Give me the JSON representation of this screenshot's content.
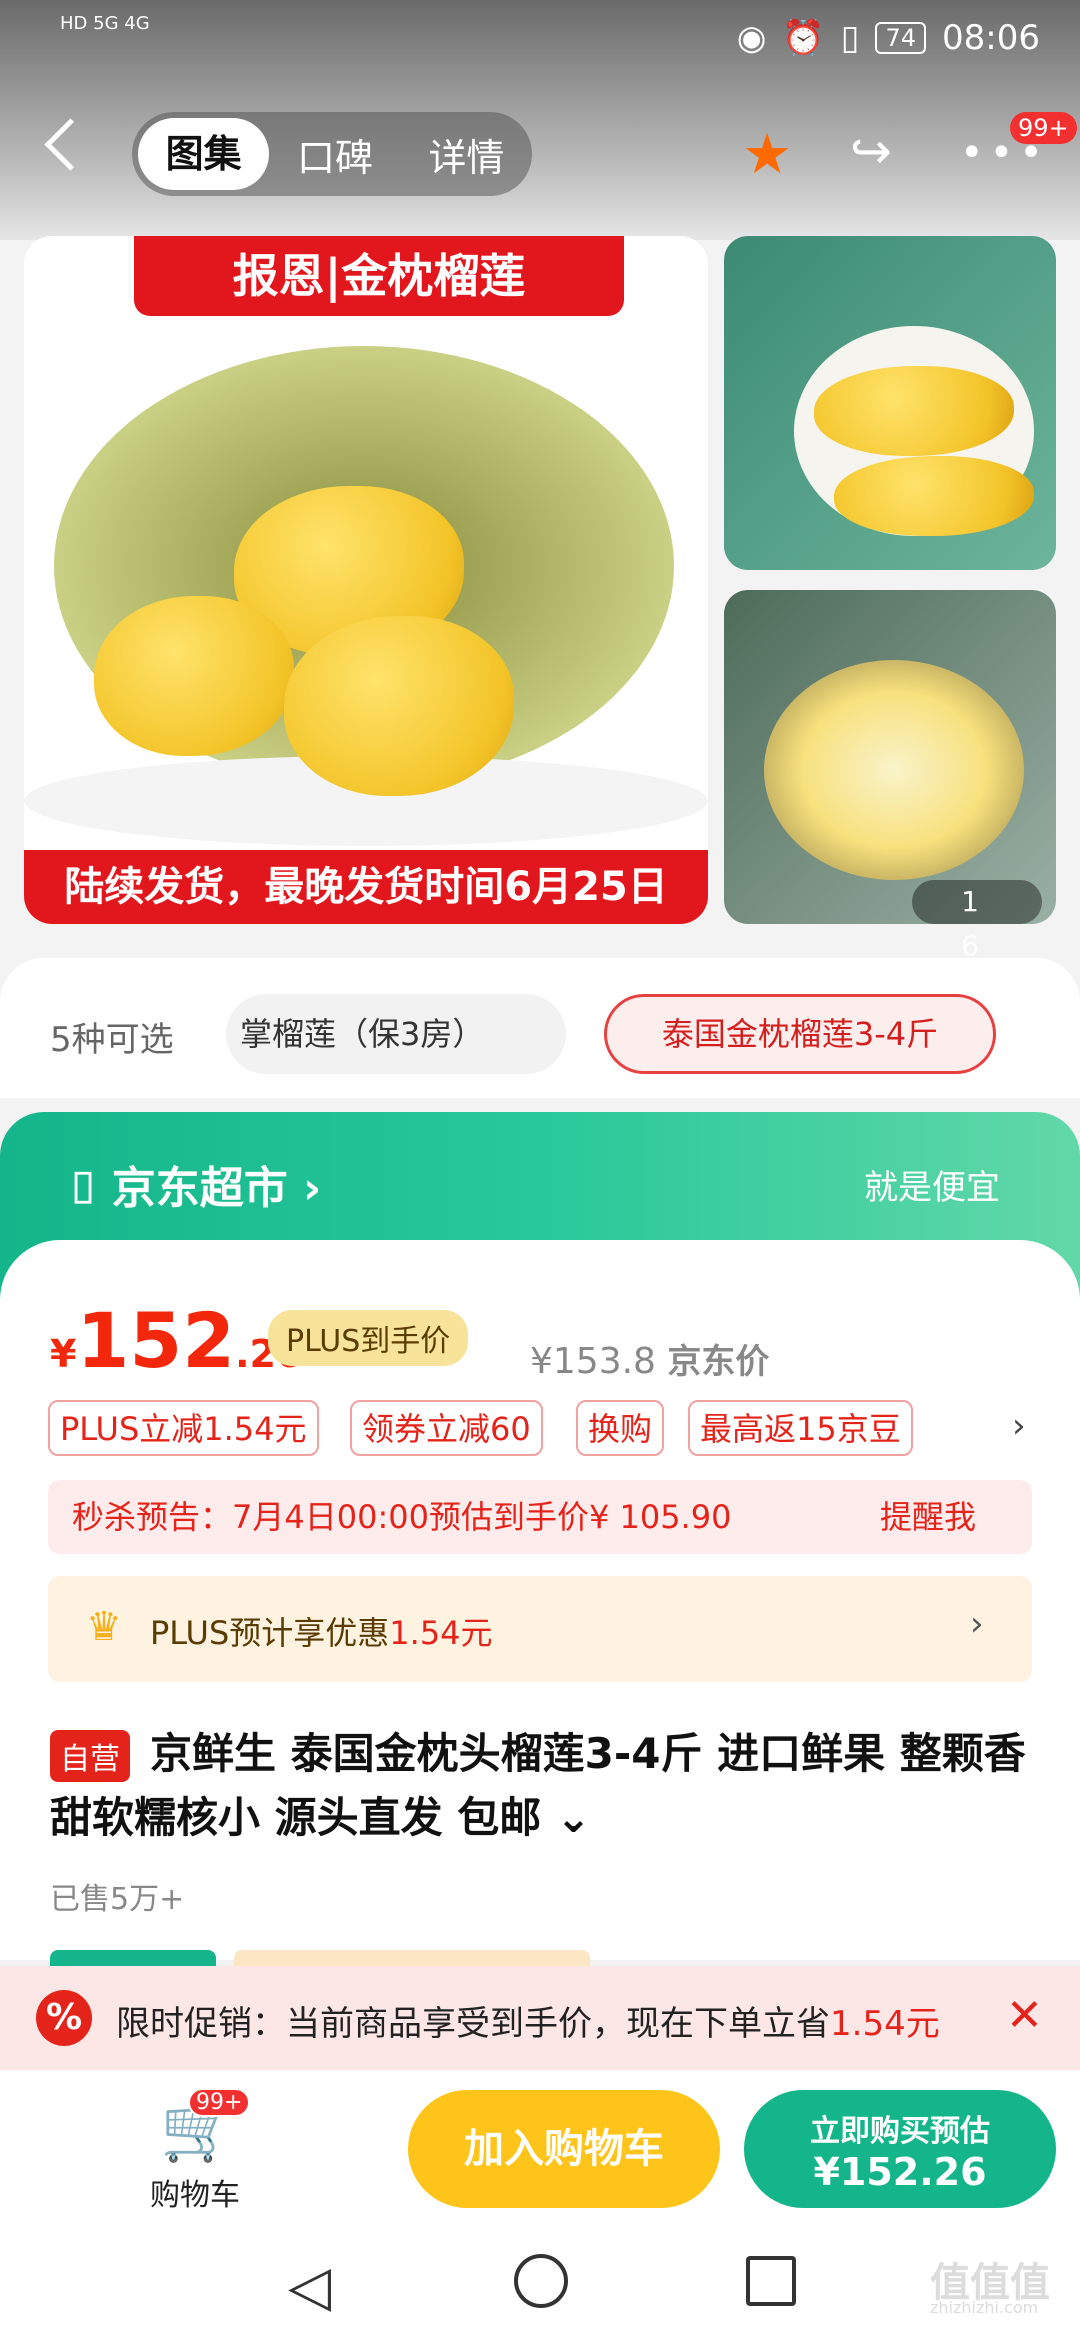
{
  "status": {
    "left_text": "HD 5G 4G",
    "battery": "74",
    "time": "08:06"
  },
  "header": {
    "tabs": [
      "图集",
      "口碑",
      "详情"
    ],
    "more_badge": "99+"
  },
  "gallery": {
    "main_banner": "报恩|金枕榴莲",
    "main_caption": "陆续发货，最晚发货时间6月25日",
    "pager": "1 6"
  },
  "options": {
    "label": "5种可选",
    "chips": [
      "掌榴莲（保3房）",
      "泰国金枕榴莲3-4斤"
    ]
  },
  "store": {
    "name": "京东超市",
    "slogan": "就是便宜"
  },
  "price": {
    "currency": "¥",
    "integer": "152",
    "decimal": ".26",
    "plus_tag": "PLUS到手价",
    "jd_price": "¥153.8",
    "jd_price_label": "京东价"
  },
  "coupons": [
    "PLUS立减1.54元",
    "领券立减60",
    "换购",
    "最高返15京豆"
  ],
  "seckill": {
    "text": "秒杀预告：7月4日00:00预估到手价¥ 105.90",
    "remind": "提醒我"
  },
  "plus_bar": {
    "text": "PLUS预计享优惠",
    "amount": "1.54元"
  },
  "product": {
    "tag": "自营",
    "title": "京鲜生 泰国金枕头榴莲3-4斤 进口鲜果 整颗香甜软糯核小 源头直发 包邮 ⌄",
    "sold": "已售5万+"
  },
  "promo": {
    "text": "限时促销：当前商品享受到手价，现在下单立省",
    "amount": "1.54元"
  },
  "bottom": {
    "cart_label": "购物车",
    "cart_badge": "99+",
    "add_cart": "加入购物车",
    "buy_line1": "立即购买预估",
    "buy_line2": "¥152.26"
  },
  "watermark": {
    "main": "值值值",
    "sub": "zhizhizhi.com"
  },
  "colors": {
    "brand_red": "#e4231a",
    "jd_green": "#14b58a",
    "cart_yellow": "#fec41a"
  }
}
